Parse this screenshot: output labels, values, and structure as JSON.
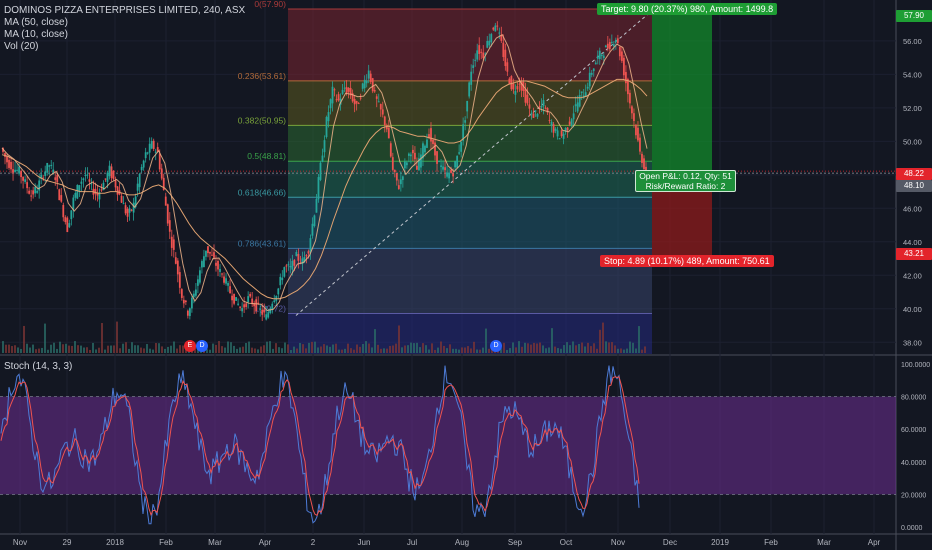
{
  "legend": {
    "title": "DOMINOS PIZZA ENTERPRISES LIMITED, 240, ASX",
    "ma50": "MA (50, close)",
    "ma10": "MA (10, close)",
    "vol": "Vol (20)"
  },
  "stoch_label": "Stoch (14, 3, 3)",
  "price_scale": {
    "ticks": [
      "56.00",
      "54.00",
      "52.00",
      "50.00",
      "48.00",
      "46.00",
      "44.00",
      "42.00",
      "40.00",
      "38.00"
    ],
    "ymin": 37.3,
    "ymax": 58.2
  },
  "stoch_scale": {
    "ticks": [
      "100.0000",
      "80.0000",
      "60.0000",
      "40.0000",
      "20.0000",
      "0.0000"
    ]
  },
  "time_axis": [
    "Nov",
    "29",
    "2018",
    "Feb",
    "Mar",
    "Apr",
    "2",
    "Jun",
    "Jul",
    "Aug",
    "Sep",
    "Oct",
    "Nov",
    "Dec",
    "2019",
    "Feb",
    "Mar",
    "Apr"
  ],
  "fib_levels": [
    {
      "label": "0(57.90)",
      "value": 57.9
    },
    {
      "label": "0.236(53.61)",
      "value": 53.61
    },
    {
      "label": "0.382(50.95)",
      "value": 50.95
    },
    {
      "label": "0.5(48.81)",
      "value": 48.81
    },
    {
      "label": "0.618(46.66)",
      "value": 46.66
    },
    {
      "label": "0.786(43.61)",
      "value": 43.61
    },
    {
      "label": "1(39.72)",
      "value": 39.72
    }
  ],
  "position": {
    "target_label": "Target: 9.80 (20.37%) 980, Amount: 1499.8",
    "stop_label": "Stop: 4.89 (10.17%) 489, Amount: 750.61",
    "pnl_line1": "Open P&L: 0.12, Qty: 51",
    "pnl_line2": "Risk/Reward Ratio: 2",
    "target_price": 57.9,
    "entry_price": 48.1,
    "stop_price": 43.21
  },
  "badges": {
    "top": "57.90",
    "last": "48.22",
    "entry": "48.10",
    "stop": "43.21"
  },
  "events": [
    "E",
    "D",
    "D"
  ],
  "colors": {
    "background": "#131722",
    "up": "#26a69a",
    "down": "#ef5350",
    "ma50": "#e0a270",
    "ma10": "#f0b48a",
    "target": "#138a2b",
    "stop": "#e31b1b",
    "stoch_k": "#4d7bd6",
    "stoch_d": "#ef5350",
    "stoch_band": "#6d2e91"
  },
  "chart_data": {
    "type": "candlestick",
    "x": [
      "Nov",
      "29",
      "2018",
      "Feb",
      "Mar",
      "Apr",
      "2",
      "Jun",
      "Jul",
      "Aug",
      "Sep",
      "Oct",
      "Nov"
    ],
    "close_path": [
      49.6,
      48.8,
      48.4,
      48.2,
      47.5,
      46.8,
      47.2,
      48.1,
      48.6,
      47.9,
      46.2,
      44.8,
      46.5,
      47.5,
      48.0,
      47.2,
      46.8,
      47.5,
      48.3,
      47.4,
      46.5,
      45.5,
      46.2,
      48.0,
      49.2,
      49.8,
      49.3,
      47.0,
      44.5,
      42.8,
      40.8,
      39.8,
      40.8,
      42.3,
      43.6,
      43.1,
      42.4,
      41.8,
      41.0,
      40.4,
      40.0,
      40.6,
      40.3,
      39.9,
      39.5,
      40.5,
      41.2,
      42.5,
      42.4,
      43.1,
      42.8,
      43.6,
      45.8,
      48.5,
      51.2,
      53.0,
      52.4,
      53.2,
      52.8,
      52.0,
      53.3,
      54.2,
      52.7,
      51.8,
      50.8,
      48.2,
      47.3,
      48.6,
      49.5,
      48.3,
      49.6,
      50.5,
      49.2,
      48.4,
      48.0,
      48.2,
      49.5,
      51.5,
      54.3,
      55.5,
      55.2,
      56.2,
      57.1,
      55.8,
      54.0,
      53.0,
      53.6,
      52.6,
      51.5,
      51.8,
      52.2,
      51.2,
      50.5,
      50.3,
      50.9,
      51.8,
      52.6,
      53.1,
      54.2,
      55.0,
      55.4,
      55.8,
      56.2,
      54.8,
      52.9,
      51.2,
      49.3,
      48.2
    ],
    "ma50": [
      49.2,
      49.1,
      48.9,
      48.7,
      48.5,
      48.2,
      47.9,
      47.7,
      47.6,
      47.5,
      47.4,
      47.2,
      47.1,
      47.0,
      47.0,
      47.0,
      46.9,
      46.9,
      47.0,
      47.0,
      46.9,
      46.8,
      46.8,
      46.9,
      47.1,
      47.3,
      47.4,
      47.2,
      46.8,
      46.3,
      45.7,
      45.1,
      44.6,
      44.2,
      43.9,
      43.6,
      43.3,
      43.0,
      42.6,
      42.2,
      41.8,
      41.5,
      41.2,
      40.9,
      40.7,
      40.6,
      40.6,
      40.7,
      40.9,
      41.1,
      41.4,
      41.8,
      42.4,
      43.2,
      44.2,
      45.3,
      46.3,
      47.3,
      48.1,
      48.8,
      49.5,
      50.1,
      50.5,
      50.8,
      50.9,
      50.8,
      50.6,
      50.5,
      50.4,
      50.3,
      50.3,
      50.2,
      50.1,
      50.0,
      49.9,
      49.9,
      50.0,
      50.3,
      50.8,
      51.4,
      51.9,
      52.4,
      52.9,
      53.2,
      53.4,
      53.5,
      53.6,
      53.6,
      53.5,
      53.4,
      53.3,
      53.1,
      52.9,
      52.7,
      52.6,
      52.6,
      52.6,
      52.7,
      52.9,
      53.1,
      53.3,
      53.5,
      53.7,
      53.7,
      53.6,
      53.4,
      53.1,
      52.7
    ],
    "volume": [],
    "ylim": [
      37.3,
      58.2
    ]
  }
}
